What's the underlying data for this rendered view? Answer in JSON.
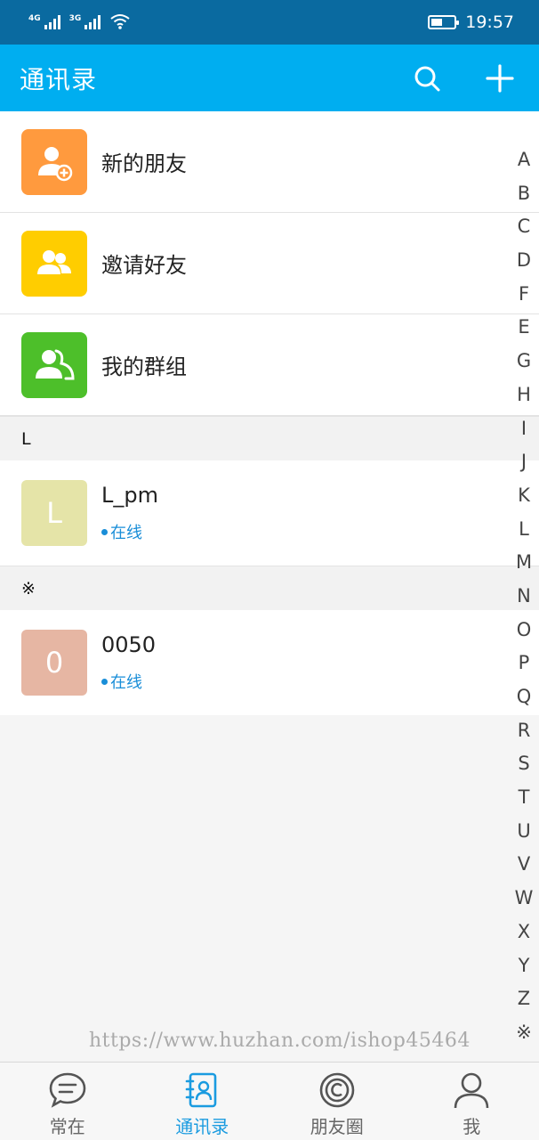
{
  "status_bar": {
    "net1": "4G",
    "net2": "3G",
    "time": "19:57"
  },
  "header": {
    "title": "通讯录"
  },
  "functions": [
    {
      "label": "新的朋友",
      "icon": "add-friend-icon",
      "color": "#ff9a3e"
    },
    {
      "label": "邀请好友",
      "icon": "invite-friends-icon",
      "color": "#ffcd00"
    },
    {
      "label": "我的群组",
      "icon": "group-icon",
      "color": "#4dbf2a"
    }
  ],
  "sections": [
    {
      "letter": "L",
      "contacts": [
        {
          "initial": "L",
          "name": "L_pm",
          "status": "在线",
          "avatar_color": "#e5e4a8"
        }
      ]
    },
    {
      "letter": "※",
      "contacts": [
        {
          "initial": "0",
          "name": "0050",
          "status": "在线",
          "avatar_color": "#e6b6a3"
        }
      ]
    }
  ],
  "index_letters": [
    "A",
    "B",
    "C",
    "D",
    "F",
    "E",
    "G",
    "H",
    "I",
    "J",
    "K",
    "L",
    "M",
    "N",
    "O",
    "P",
    "Q",
    "R",
    "S",
    "T",
    "U",
    "V",
    "W",
    "X",
    "Y",
    "Z",
    "※"
  ],
  "watermark": "https://www.huzhan.com/ishop45464",
  "bottom_nav": [
    {
      "label": "常在",
      "icon": "chat-icon"
    },
    {
      "label": "通讯录",
      "icon": "contacts-icon",
      "active": true
    },
    {
      "label": "朋友圈",
      "icon": "moments-icon"
    },
    {
      "label": "我",
      "icon": "profile-icon"
    }
  ],
  "colors": {
    "status_bar": "#0a6aa0",
    "header": "#00aef0",
    "active_nav": "#1a9be0",
    "online": "#1a8ed8"
  }
}
